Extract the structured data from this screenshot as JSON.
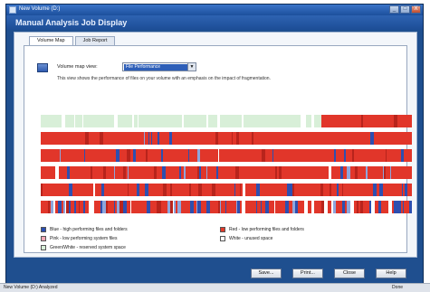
{
  "window": {
    "title": "New Volume (D:)",
    "buttons": [
      "_",
      "□",
      "X"
    ]
  },
  "header": {
    "title": "Manual Analysis Job Display"
  },
  "tabs": [
    {
      "label": "Volume Map",
      "active": true
    },
    {
      "label": "Job Report",
      "active": false
    }
  ],
  "view": {
    "label": "Volume map view:",
    "selected": "File Performance",
    "description": "This view shows the performance of files on your volume with an emphasis on the impact of fragmentation."
  },
  "legend": [
    {
      "label": "Blue - high performing files and folders",
      "color": "#2a4fb3"
    },
    {
      "label": "Red - low performing files and folders",
      "color": "#e23a2b"
    },
    {
      "label": "Pink - low performing system files",
      "color": "#f3a7b4"
    },
    {
      "label": "White - unused space",
      "color": "#ffffff"
    },
    {
      "label": "Green/White - reserved system space",
      "color": "#d8efd8"
    }
  ],
  "buttons": {
    "save": "Save...",
    "print": "Print...",
    "close": "Close",
    "help": "Help"
  },
  "status": {
    "left": "New Volume (D:) Analyzed",
    "right": "Done"
  },
  "map_colors": {
    "red": "#e1362a",
    "dark_red": "#b8241c",
    "blue": "#2d4fb0",
    "pale_blue": "#8ea6dc",
    "green": "#d8efd8",
    "white": "#ffffff",
    "pink": "#f3a7b4"
  }
}
